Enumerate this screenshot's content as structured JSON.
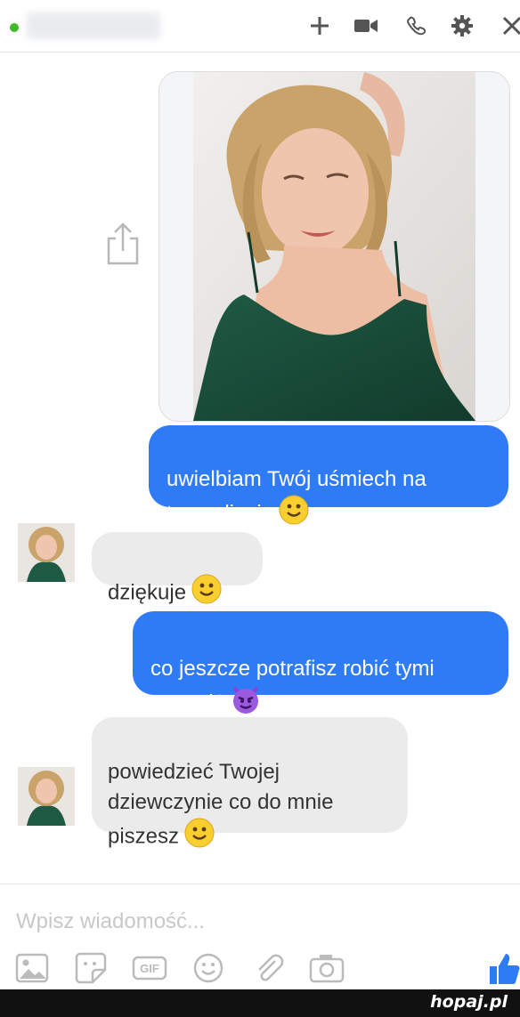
{
  "header": {
    "contact_name": "",
    "icons": [
      "add-person-icon",
      "video-call-icon",
      "phone-icon",
      "gear-icon",
      "close-icon"
    ]
  },
  "messages": [
    {
      "direction": "outgoing",
      "type": "image"
    },
    {
      "direction": "outgoing",
      "type": "text",
      "text": "uwielbiam Twój uśmiech na\ntym zdjęciu",
      "emoji": "smile"
    },
    {
      "direction": "incoming",
      "type": "text",
      "text": "dziękuje",
      "emoji": "smile"
    },
    {
      "direction": "outgoing",
      "type": "text",
      "text": "co jeszcze potrafisz robić tymi\nustami?",
      "emoji": "devil"
    },
    {
      "direction": "incoming",
      "type": "text",
      "text": "powiedzieć Twojej\ndziewczynie co do mnie\npiszesz",
      "emoji": "smile"
    }
  ],
  "composer": {
    "placeholder": "Wpisz wiadomość...",
    "tools": [
      "image-icon",
      "sticker-icon",
      "gif-icon",
      "emoji-icon",
      "attachment-icon",
      "camera-icon",
      "like-icon"
    ],
    "gif_label": "GIF"
  },
  "watermark": "hopaj.pl",
  "colors": {
    "outgoing_bubble": "#2f7bf5",
    "incoming_bubble": "#ebebeb",
    "online": "#42b72a",
    "like": "#2f7bf5"
  }
}
